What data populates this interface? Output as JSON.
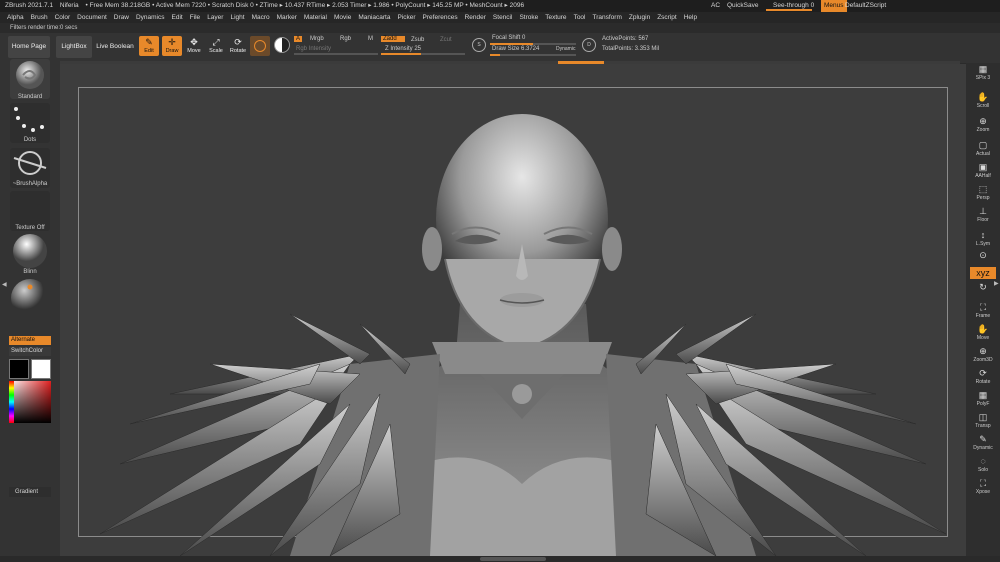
{
  "titlebar": {
    "app": "ZBrush 2021.7.1",
    "doc": "Niferia",
    "stats": "• Free Mem 38.218GB • Active Mem 7220 • Scratch Disk 0 • ZTime ▸ 10.437 RTime ▸ 2.053 Timer ▸ 1.986 • PolyCount ▸ 145.25 MP • MeshCount ▸ 2096",
    "ac": "AC",
    "quicksave": "QuickSave",
    "see_through": "See-through  0",
    "menus": "Menus",
    "default_zscript": "DefaultZScript"
  },
  "menubar": [
    "Alpha",
    "Brush",
    "Color",
    "Document",
    "Draw",
    "Dynamics",
    "Edit",
    "File",
    "Layer",
    "Light",
    "Macro",
    "Marker",
    "Material",
    "Movie",
    "Maniacarta",
    "Picker",
    "Preferences",
    "Render",
    "Stencil",
    "Stroke",
    "Texture",
    "Tool",
    "Transform",
    "Zplugin",
    "Zscript",
    "Help"
  ],
  "status": "Filters render time:0 secs",
  "toolbar": {
    "home_page": "Home Page",
    "lightbox": "LightBox",
    "live_boolean": "Live Boolean",
    "tools": [
      {
        "glyph": "✎",
        "label": "Edit"
      },
      {
        "glyph": "✛",
        "label": "Draw"
      },
      {
        "glyph": "✥",
        "label": "Move"
      },
      {
        "glyph": "⤢",
        "label": "Scale"
      },
      {
        "glyph": "⟳",
        "label": "Rotate"
      }
    ],
    "a": "A",
    "mrgb": "Mrgb",
    "rgb": "Rgb",
    "m": "M",
    "rgb_intensity": "Rgb Intensity",
    "zadd": "Zadd",
    "zsub": "Zsub",
    "zcut": "Zcut",
    "z_intensity": "Z Intensity 25",
    "focal_shift": "Focal Shift 0",
    "draw_size": "Draw Size 6.3724",
    "dynamic": "Dynamic",
    "active_points": "ActivePoints: 567",
    "total_points": "TotalPoints: 3.353 Mil",
    "s_icon": "S",
    "d_icon": "D"
  },
  "lefttray": {
    "standard": "Standard",
    "dots": "Dots",
    "brush_alpha": "~BrushAlpha",
    "texture_off": "Texture Off",
    "blinn": "Blinn",
    "alternate": "Alternate",
    "switch_color": "SwitchColor",
    "gradient": "Gradient"
  },
  "righttray": [
    {
      "glyph": "▦",
      "label": "SPix 3",
      "name": "bpr"
    },
    {
      "glyph": "✋",
      "label": "Scroll",
      "name": "scroll"
    },
    {
      "glyph": "⊕",
      "label": "Zoom",
      "name": "zoom"
    },
    {
      "glyph": "▢",
      "label": "Actual",
      "name": "actual"
    },
    {
      "glyph": "▣",
      "label": "AAHalf",
      "name": "aahalf"
    },
    {
      "glyph": "⬚",
      "label": "Persp",
      "name": "persp"
    },
    {
      "glyph": "⊥",
      "label": "Floor",
      "name": "floor"
    },
    {
      "glyph": "↕",
      "label": "L.Sym",
      "name": "lsym"
    },
    {
      "glyph": "⊙",
      "label": "",
      "name": "local"
    },
    {
      "glyph": "xyz",
      "label": "",
      "name": "xyz",
      "on": true
    },
    {
      "glyph": "↻",
      "label": "",
      "name": "rotate-axis"
    },
    {
      "glyph": "⛶",
      "label": "Frame",
      "name": "frame"
    },
    {
      "glyph": "✋",
      "label": "Move",
      "name": "move"
    },
    {
      "glyph": "⊕",
      "label": "Zoom3D",
      "name": "zoom3d"
    },
    {
      "glyph": "⟳",
      "label": "Rotate",
      "name": "rotate"
    },
    {
      "glyph": "▦",
      "label": "PolyF",
      "name": "polyf"
    },
    {
      "glyph": "◫",
      "label": "Transp",
      "name": "transp"
    },
    {
      "glyph": "✎",
      "label": "Dynamic",
      "name": "dynamic"
    },
    {
      "glyph": "◌",
      "label": "Solo",
      "name": "solo"
    },
    {
      "glyph": "⛶",
      "label": "Xpose",
      "name": "xpose"
    }
  ],
  "colors": {
    "accent": "#e8892a",
    "bg": "#2b2b2b",
    "canvas": "#3d3d3d"
  }
}
